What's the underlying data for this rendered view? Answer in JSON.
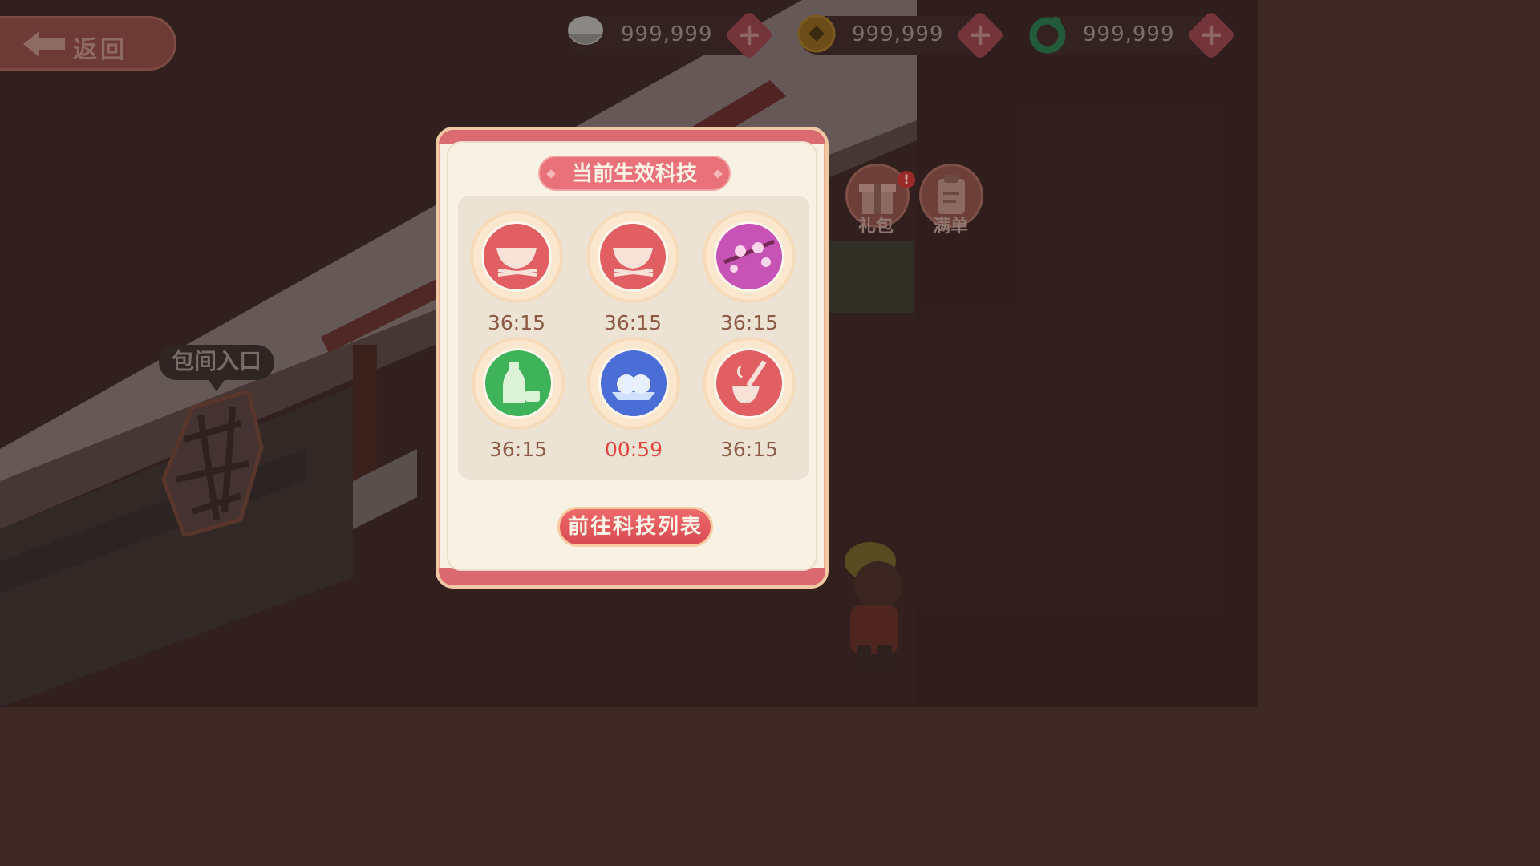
{
  "topbar": {
    "back_label": "返回",
    "currencies": [
      {
        "icon": "rice-bowl-icon",
        "value": "999,999",
        "color": "#e9e6e0"
      },
      {
        "icon": "copper-coin-icon",
        "value": "999,999",
        "color": "#b07a1c"
      },
      {
        "icon": "jade-dragon-icon",
        "value": "999,999",
        "color": "#2e7a4e"
      }
    ],
    "plus_symbol": "+"
  },
  "side_buttons": {
    "gift": {
      "label": "礼包",
      "badge": "!"
    },
    "full_order": {
      "label": "满单"
    }
  },
  "scene": {
    "entrance_label": "包间入口"
  },
  "modal": {
    "title": "当前生效科技",
    "techs": [
      {
        "icon": "bowl-chopsticks-icon",
        "time": "36:15",
        "urgent": false,
        "color": "#e15e63"
      },
      {
        "icon": "bowl-chopsticks-icon",
        "time": "36:15",
        "urgent": false,
        "color": "#e15e63"
      },
      {
        "icon": "plum-blossom-icon",
        "time": "36:15",
        "urgent": false,
        "color": "#c653b5"
      },
      {
        "icon": "wine-bottle-icon",
        "time": "36:15",
        "urgent": false,
        "color": "#3fb35a"
      },
      {
        "icon": "steamed-buns-icon",
        "time": "00:59",
        "urgent": true,
        "color": "#4a6ed6"
      },
      {
        "icon": "soup-ladle-icon",
        "time": "36:15",
        "urgent": false,
        "color": "#e15e63"
      }
    ],
    "go_button": "前往科技列表"
  }
}
